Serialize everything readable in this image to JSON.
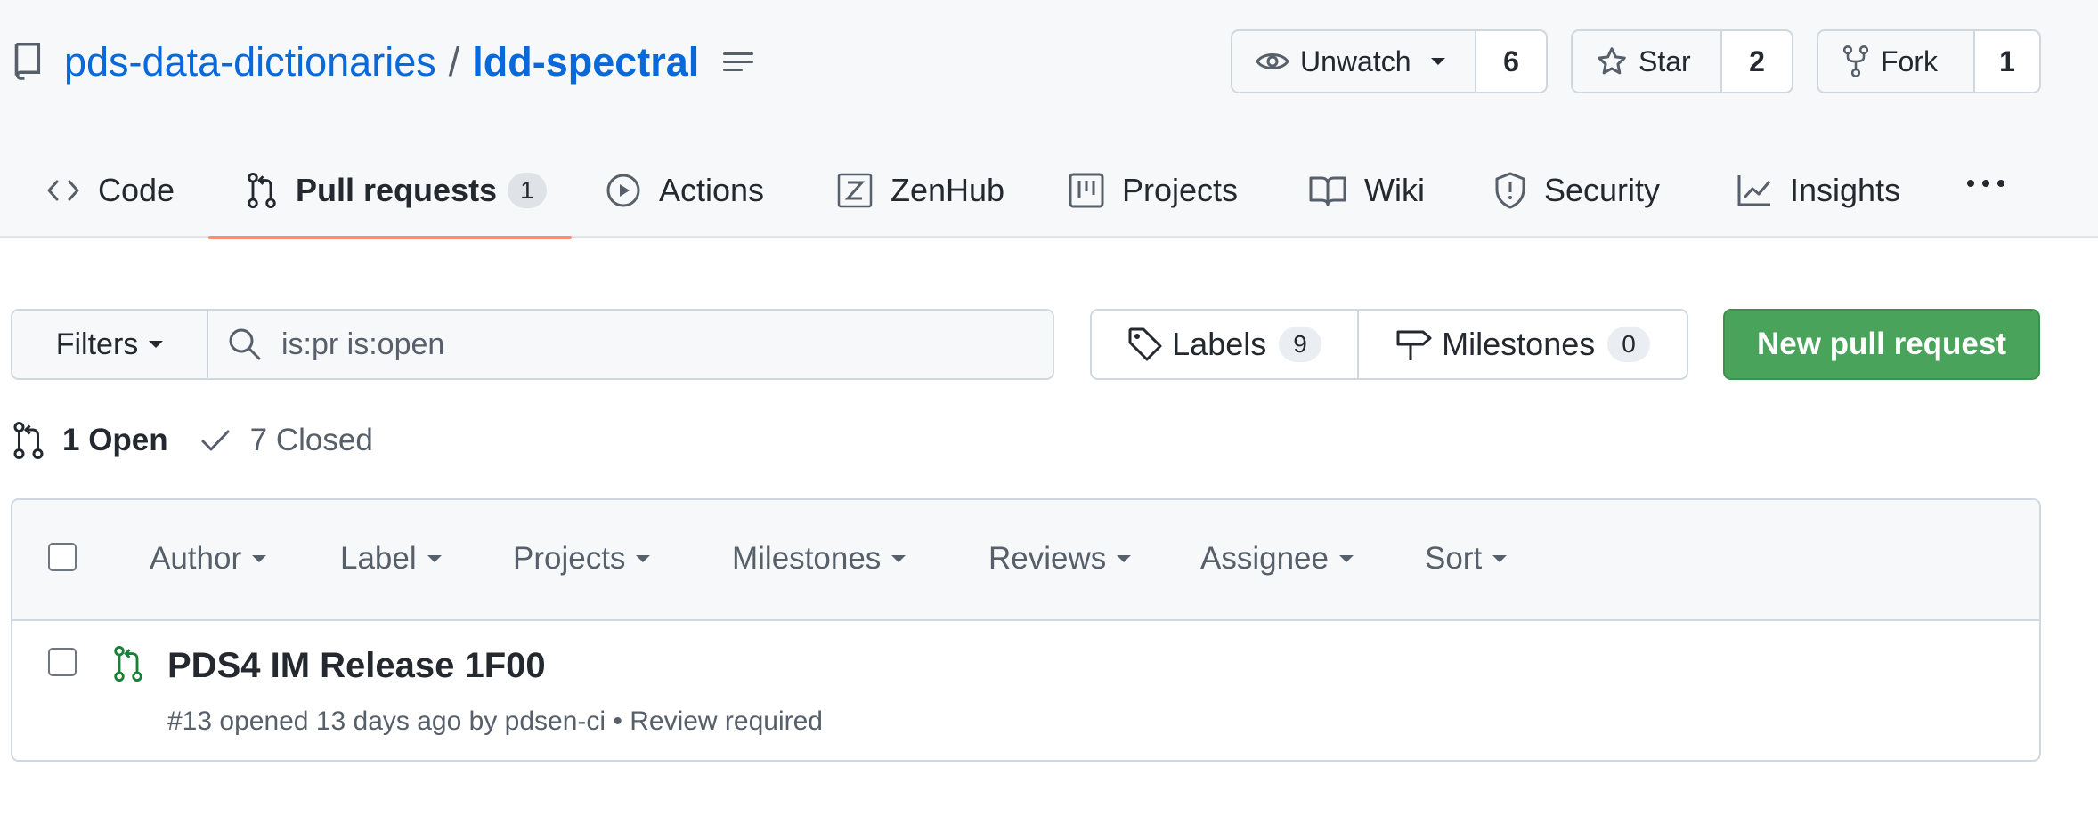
{
  "repo": {
    "owner": "pds-data-dictionaries",
    "separator": "/",
    "name": "ldd-spectral"
  },
  "social": {
    "watch_label": "Unwatch",
    "watch_count": "6",
    "star_label": "Star",
    "star_count": "2",
    "fork_label": "Fork",
    "fork_count": "1"
  },
  "tabs": [
    {
      "label": "Code",
      "icon": "code-icon"
    },
    {
      "label": "Pull requests",
      "icon": "git-pull-request-icon",
      "counter": "1",
      "selected": true
    },
    {
      "label": "Actions",
      "icon": "play-icon"
    },
    {
      "label": "ZenHub",
      "icon": "zenhub-icon"
    },
    {
      "label": "Projects",
      "icon": "project-icon"
    },
    {
      "label": "Wiki",
      "icon": "book-icon"
    },
    {
      "label": "Security",
      "icon": "shield-icon"
    },
    {
      "label": "Insights",
      "icon": "graph-icon"
    }
  ],
  "toolbar": {
    "filters_label": "Filters",
    "search_value": "is:pr is:open",
    "labels_label": "Labels",
    "labels_count": "9",
    "milestones_label": "Milestones",
    "milestones_count": "0",
    "new_pr_label": "New pull request"
  },
  "states": {
    "open_label": "1 Open",
    "closed_label": "7 Closed"
  },
  "list_header": {
    "author": "Author",
    "label": "Label",
    "projects": "Projects",
    "milestones": "Milestones",
    "reviews": "Reviews",
    "assignee": "Assignee",
    "sort": "Sort"
  },
  "pull_requests": [
    {
      "title": "PDS4 IM Release 1F00",
      "meta": "#13 opened 13 days ago by pdsen-ci • Review required"
    }
  ],
  "colors": {
    "accent_link": "#0969da",
    "primary_button": "#4aa35a",
    "tab_underline": "#fd8c73",
    "open_icon": "#1a7f37"
  }
}
